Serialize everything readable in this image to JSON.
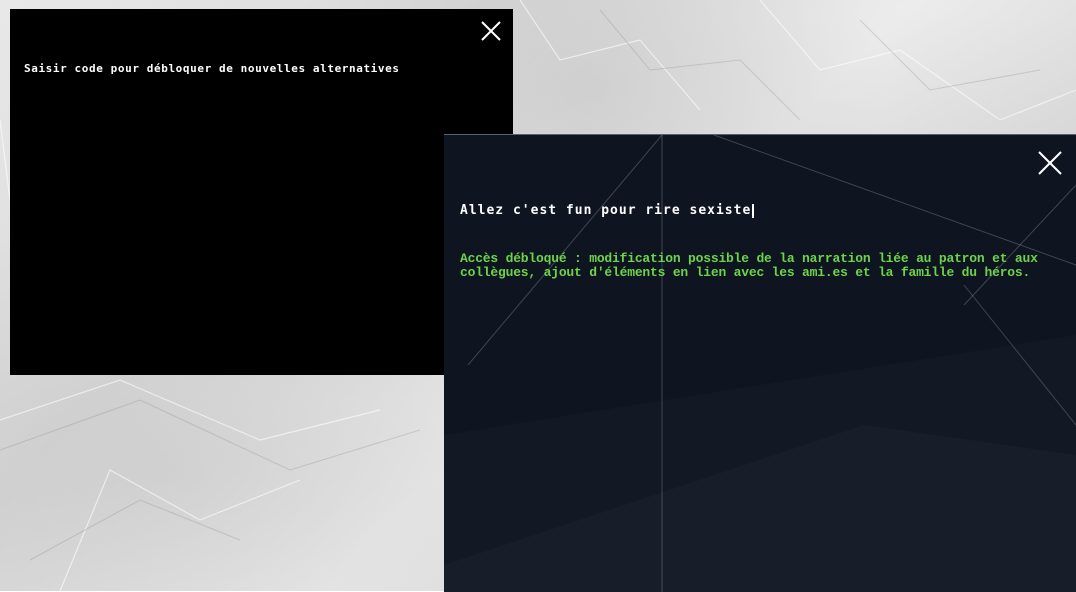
{
  "window_code_entry": {
    "prompt": "Saisir code pour débloquer de nouvelles alternatives",
    "close_icon": "close-icon"
  },
  "window_result": {
    "entered_text": "Allez c'est fun pour rire sexiste",
    "unlocked_message": "Accès débloqué : modification possible de la narration liée au patron et aux collègues, ajout d'éléments en lien avec les ami.es et la famille du héros.",
    "close_icon": "close-icon"
  },
  "colors": {
    "background": "#e3e3e3",
    "window_black": "#000000",
    "window_navy": "#0e1420",
    "text_white": "#ffffff",
    "text_green": "#6dd44a"
  }
}
